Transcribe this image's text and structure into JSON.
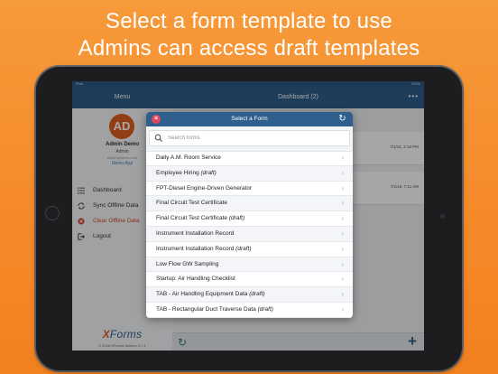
{
  "headline": {
    "line1": "Select a form template to use",
    "line2": "Admins can access draft templates"
  },
  "statusbar": {
    "left": "iPad",
    "right": "100%"
  },
  "sidebar": {
    "title": "Menu",
    "user": {
      "initials": "AD",
      "name": "Admin Demo",
      "role": "Admin",
      "email": "admin@demo.com",
      "app": "Demo App"
    },
    "items": [
      {
        "label": "Dashboard",
        "icon": "list-icon"
      },
      {
        "label": "Sync Offline Data",
        "icon": "sync-icon"
      },
      {
        "label": "Clear Offline Data",
        "icon": "clear-icon"
      },
      {
        "label": "Logout",
        "icon": "logout-icon"
      }
    ],
    "logo": {
      "x": "X",
      "rest": "Forms"
    },
    "copyright": "© 2018 XForms Version 3.7.1"
  },
  "main": {
    "title": "Dashboard (2)",
    "more": "•••",
    "rows": [
      {
        "time": "7/1/16, 2:18 PM"
      },
      {
        "time": "7/1/16, 7:11 AM"
      }
    ]
  },
  "modal": {
    "title": "Select a Form",
    "close": "×",
    "refresh": "↻",
    "search_placeholder": "Search forms",
    "forms": [
      {
        "name": "Daily A.M. Room Service",
        "tag": ""
      },
      {
        "name": "Employee Hiring",
        "tag": "(draft)"
      },
      {
        "name": "FPT-Diesel Engine-Driven Generator",
        "tag": ""
      },
      {
        "name": "Final Circuit Test Certificate",
        "tag": ""
      },
      {
        "name": "Final Circuit Test Certificate",
        "tag": "(draft)"
      },
      {
        "name": "Instrument Installation Record",
        "tag": ""
      },
      {
        "name": "Instrument Installation Record",
        "tag": "(draft)"
      },
      {
        "name": "Low Flow GW Sampling",
        "tag": ""
      },
      {
        "name": "Startup: Air Handling Checklist",
        "tag": ""
      },
      {
        "name": "TAB - Air Handling Equipment Data",
        "tag": "(draft)"
      },
      {
        "name": "TAB - Rectangular Duct Traverse Data",
        "tag": "(draft)"
      }
    ]
  },
  "colors": {
    "background": "#f58a2b",
    "header": "#2f5f8c",
    "avatar": "#e25f1f",
    "close": "#e0485f",
    "danger": "#d6492e"
  }
}
